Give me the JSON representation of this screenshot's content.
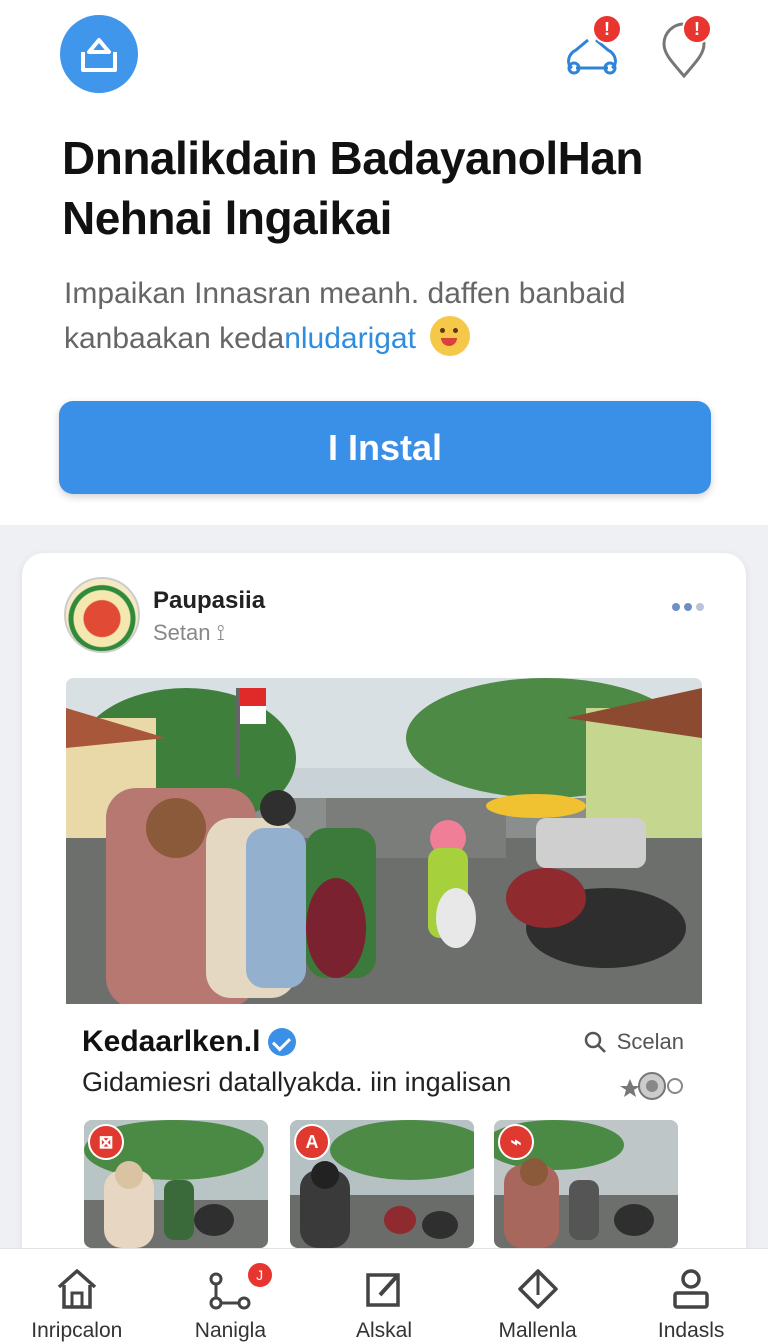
{
  "header": {
    "title": "Dnnalikdain BadayanolHan Nehnai lngaikai",
    "subtitle_plain": "Impaikan Innasran meanh. daffen banbaid kanbaakan keda",
    "subtitle_link": "nludarigat",
    "install_label": "I Instal",
    "notification_badge": "!",
    "location_badge": "!"
  },
  "post": {
    "author": "Paupasiia",
    "author_sub": "Setan ⟟",
    "info_title": "Kedaarlken.l",
    "search_label": "Scelan",
    "info_text": "Gidamiesri datallyakda. iin ingalisan",
    "thumbnails": [
      {
        "badge": "⊠"
      },
      {
        "badge": "A"
      },
      {
        "badge": "⌁"
      }
    ]
  },
  "nav": {
    "items": [
      {
        "label": "Inripcalon",
        "icon": "home-icon"
      },
      {
        "label": "Nanigla",
        "icon": "share-icon",
        "badge": "J"
      },
      {
        "label": "Alskal",
        "icon": "edit-icon"
      },
      {
        "label": "Mallenla",
        "icon": "diamond-icon"
      },
      {
        "label": "Indasls",
        "icon": "profile-icon"
      }
    ]
  },
  "colors": {
    "accent": "#3a8fe7",
    "badge": "#e8352f",
    "feed_bg": "#eef0f3"
  }
}
